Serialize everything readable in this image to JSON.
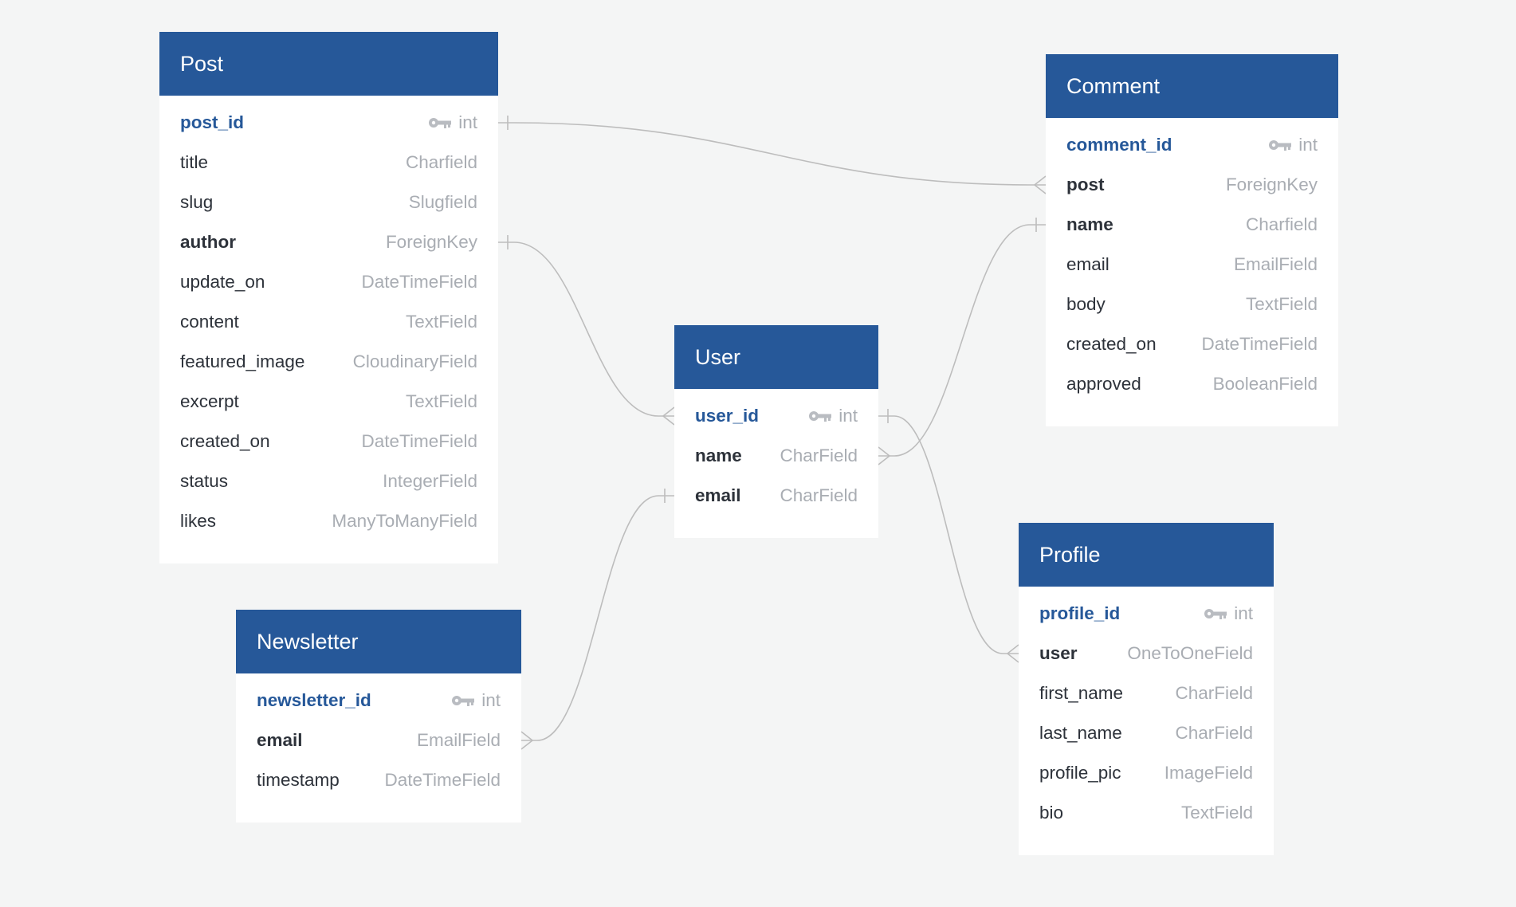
{
  "tables": {
    "post": {
      "title": "Post",
      "fields": [
        {
          "name": "post_id",
          "type": "int",
          "pk": true
        },
        {
          "name": "title",
          "type": "Charfield"
        },
        {
          "name": "slug",
          "type": "Slugfield"
        },
        {
          "name": "author",
          "type": "ForeignKey",
          "bold": true
        },
        {
          "name": "update_on",
          "type": "DateTimeField"
        },
        {
          "name": "content",
          "type": "TextField"
        },
        {
          "name": "featured_image",
          "type": "CloudinaryField"
        },
        {
          "name": "excerpt",
          "type": "TextField"
        },
        {
          "name": "created_on",
          "type": "DateTimeField"
        },
        {
          "name": "status",
          "type": "IntegerField"
        },
        {
          "name": "likes",
          "type": "ManyToManyField"
        }
      ]
    },
    "comment": {
      "title": "Comment",
      "fields": [
        {
          "name": "comment_id",
          "type": "int",
          "pk": true
        },
        {
          "name": "post",
          "type": "ForeignKey",
          "bold": true
        },
        {
          "name": "name",
          "type": "Charfield",
          "bold": true
        },
        {
          "name": "email",
          "type": "EmailField"
        },
        {
          "name": "body",
          "type": "TextField"
        },
        {
          "name": "created_on",
          "type": "DateTimeField"
        },
        {
          "name": "approved",
          "type": "BooleanField"
        }
      ]
    },
    "user": {
      "title": "User",
      "fields": [
        {
          "name": "user_id",
          "type": "int",
          "pk": true
        },
        {
          "name": "name",
          "type": "CharField",
          "bold": true
        },
        {
          "name": "email",
          "type": "CharField",
          "bold": true
        }
      ]
    },
    "profile": {
      "title": "Profile",
      "fields": [
        {
          "name": "profile_id",
          "type": "int",
          "pk": true
        },
        {
          "name": "user",
          "type": "OneToOneField",
          "bold": true
        },
        {
          "name": "first_name",
          "type": "CharField"
        },
        {
          "name": "last_name",
          "type": "CharField"
        },
        {
          "name": "profile_pic",
          "type": "ImageField"
        },
        {
          "name": "bio",
          "type": "TextField"
        }
      ]
    },
    "newsletter": {
      "title": "Newsletter",
      "fields": [
        {
          "name": "newsletter_id",
          "type": "int",
          "pk": true
        },
        {
          "name": "email",
          "type": "EmailField",
          "bold": true
        },
        {
          "name": "timestamp",
          "type": "DateTimeField"
        }
      ]
    }
  },
  "relations": [
    {
      "from": "post.post_id",
      "to": "comment.post",
      "from_end": "one",
      "to_end": "many"
    },
    {
      "from": "post.author",
      "to": "user.user_id",
      "from_end": "one",
      "to_end": "many"
    },
    {
      "from": "user.user_id",
      "to": "profile.user",
      "from_end": "one",
      "to_end": "many"
    },
    {
      "from": "user.name",
      "to": "comment.name",
      "from_end": "many",
      "to_end": "one"
    },
    {
      "from": "user.email",
      "to": "newsletter.email",
      "from_end": "one",
      "to_end": "many"
    }
  ],
  "colors": {
    "header": "#265899",
    "pk_text": "#265899",
    "type_text": "#a9adb3",
    "line": "#bdbdbd",
    "background": "#f4f5f5"
  },
  "icons": {
    "primary_key": "key-icon"
  }
}
